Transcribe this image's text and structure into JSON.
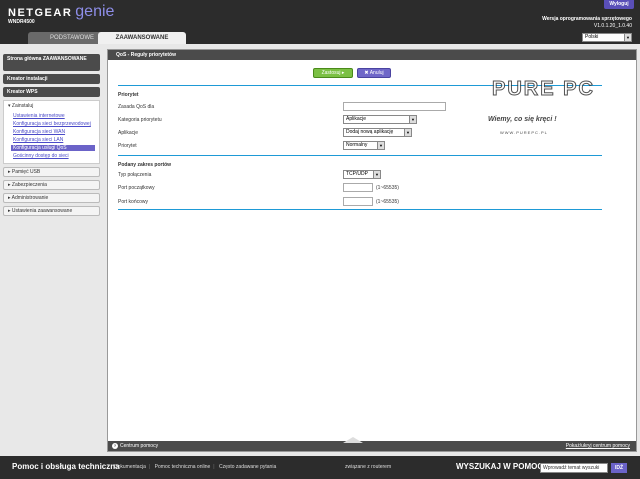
{
  "header": {
    "brand": "NETGEAR",
    "brand_genie": "genie",
    "model": "WNDR4500",
    "logout": "Wyloguj",
    "firmware_label": "Wersja oprogramowania sprzętowego",
    "firmware_value": "V1.0.1.20_1.0.40",
    "tabs": [
      "PODSTAWOWE",
      "ZAAWANSOWANE"
    ],
    "language": "Polski"
  },
  "sidebar": {
    "home": "Strona główna ZAAWANSOWANE",
    "setup_wizard": "Kreator instalacji",
    "wps_wizard": "Kreator WPS",
    "setup_group": "Zainstaluj",
    "setup_links": [
      "Ustawienia internetowe",
      "Konfiguracja sieci bezprzewodowej",
      "Konfiguracja sieci WAN",
      "Konfiguracja sieci LAN",
      "Konfiguracja usługi QoS",
      "Gościnny dostęp do sieci"
    ],
    "sections": [
      "Pamięć USB",
      "Zabezpieczenia",
      "Administrowanie",
      "Ustawienia zaawansowane"
    ]
  },
  "main": {
    "title": "QoS - Reguły priorytetów",
    "apply": "Zastosuj",
    "cancel": "Anuluj",
    "priority_section": "Priorytet",
    "rule_label": "Zasada QoS dla",
    "rule_value": "",
    "category_label": "Kategoria priorytetu",
    "category_value": "Aplikacje",
    "app_label": "Aplikacje",
    "app_value": "Dodaj nową aplikację",
    "priority_label": "Priorytet",
    "priority_value": "Normalny",
    "ports_section": "Podany zakres portów",
    "conn_label": "Typ połączenia",
    "conn_value": "TCP/UDP",
    "start_label": "Port początkowy",
    "start_hint": "(1~65535)",
    "end_label": "Port końcowy",
    "end_hint": "(1~65535)",
    "help_center": "Centrum pomocy",
    "toggle_help": "Pokaż/ukryj centrum pomocy"
  },
  "watermark": {
    "logo": "PURE PC",
    "tagline": "Wiemy, co się kręci !",
    "url": "WWW.PUREPC.PL"
  },
  "bottombar": {
    "title": "Pomoc i obsługa techniczna",
    "links": [
      "Dokumentacja",
      "Pomoc techniczna online",
      "Często zadawane pytania"
    ],
    "router": "związane z routerem",
    "search_label": "WYSZUKAJ W POMOCY",
    "search_placeholder": "Wprowadź temat wyszuki",
    "go": "IDŹ"
  }
}
